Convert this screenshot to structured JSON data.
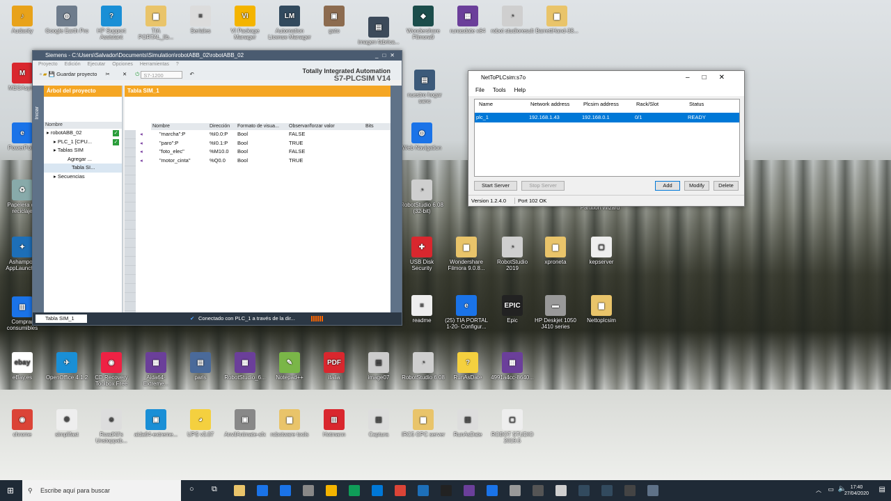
{
  "desktop": {
    "icons": [
      {
        "label": "Audacity",
        "color": "#e8a21a",
        "glyph": "♪"
      },
      {
        "label": "Google Earth Pro",
        "color": "#6e7c8c",
        "glyph": "◍"
      },
      {
        "label": "HP Support Assistant",
        "color": "#1a8fd6",
        "glyph": "?"
      },
      {
        "label": "TIA PORTAL_lib...",
        "color": "#e9c46a",
        "glyph": "▆"
      },
      {
        "label": "Seriales",
        "color": "#dcdcdc",
        "glyph": "≡"
      },
      {
        "label": "VI Package Manager",
        "color": "#f4b400",
        "glyph": "VI"
      },
      {
        "label": "Automation License Manager",
        "color": "#324a5e",
        "glyph": "LM"
      },
      {
        "label": "gato",
        "color": "#8c6b4f",
        "glyph": "▣"
      },
      {
        "label": "imagen fabrica...",
        "color": "#3c4a5a",
        "glyph": "▤"
      },
      {
        "label": "Wondershare Filmora9",
        "color": "#1b4d4b",
        "glyph": "◆"
      },
      {
        "label": "runasdate x64",
        "color": "#6b3f9a",
        "glyph": "▦"
      },
      {
        "label": "robot studioresult",
        "color": "#cfcfcf",
        "glyph": "◔"
      },
      {
        "label": "BarrettHand-38...",
        "color": "#e9c46a",
        "glyph": "▆"
      },
      {
        "label": "MEGAsync",
        "color": "#d9272e",
        "glyph": "M"
      },
      {
        "label": "PowerPoint",
        "color": "#1a73e8",
        "glyph": "e"
      },
      {
        "label": "Papelera de reciclaje",
        "color": "#8aa",
        "glyph": "♻"
      },
      {
        "label": "Ashampoo AppLauncher",
        "color": "#1d6fb8",
        "glyph": "✦"
      },
      {
        "label": "Comprar consumibles",
        "color": "#1a73e8",
        "glyph": "▥"
      },
      {
        "label": "nuestro hogar sano",
        "color": "#3c5a7a",
        "glyph": "▤"
      },
      {
        "label": "Web Navigation",
        "color": "#1a73e8",
        "glyph": "◍"
      },
      {
        "label": "RobotStudio 6.08 (32-bit)",
        "color": "#cfcfcf",
        "glyph": "◔"
      },
      {
        "label": "USB Disk Security",
        "color": "#d9272e",
        "glyph": "✚"
      },
      {
        "label": "Wondershare Filmora 9.0.8...",
        "color": "#e9c46a",
        "glyph": "▆"
      },
      {
        "label": "RobotStudio 2019",
        "color": "#cfcfcf",
        "glyph": "◔"
      },
      {
        "label": "xproneta",
        "color": "#e9c46a",
        "glyph": "▆"
      },
      {
        "label": "kepserver",
        "color": "#eee",
        "glyph": "▢"
      },
      {
        "label": "readme",
        "color": "#eee",
        "glyph": "≡"
      },
      {
        "label": "(25) TIA PORTAL 1-20- Configur...",
        "color": "#1a73e8",
        "glyph": "e"
      },
      {
        "label": "Epic",
        "color": "#222",
        "glyph": "EPIC"
      },
      {
        "label": "HP Deskjet 1050 J410 series",
        "color": "#999",
        "glyph": "▬"
      },
      {
        "label": "Nettoplcsim",
        "color": "#e9c46a",
        "glyph": "▆"
      },
      {
        "label": "eBay.es",
        "color": "#fff",
        "glyph": "ebay"
      },
      {
        "label": "OpenOffice 4.1.2",
        "color": "#1a8fd6",
        "glyph": "✈"
      },
      {
        "label": "CD Recovery Toolbox Free",
        "color": "#e24",
        "glyph": "◉"
      },
      {
        "label": "Aida64-Extreme...",
        "color": "#6b3f9a",
        "glyph": "▦"
      },
      {
        "label": "paris",
        "color": "#4a6a9a",
        "glyph": "▤"
      },
      {
        "label": "RobotStudio_6...",
        "color": "#6b3f9a",
        "glyph": "▦"
      },
      {
        "label": "Notepad++",
        "color": "#7ab648",
        "glyph": "✎"
      },
      {
        "label": "italia",
        "color": "#d9272e",
        "glyph": "PDF"
      },
      {
        "label": "image07",
        "color": "#ccc",
        "glyph": "▤"
      },
      {
        "label": "RobotStudio 6.08",
        "color": "#cfcfcf",
        "glyph": "◔"
      },
      {
        "label": "RunAsDate",
        "color": "#f4d03f",
        "glyph": "?"
      },
      {
        "label": "4991a4cc-8640...",
        "color": "#6b3f9a",
        "glyph": "▦"
      },
      {
        "label": "chrome",
        "color": "#db4437",
        "glyph": "◉"
      },
      {
        "label": "simplifast",
        "color": "#eee",
        "glyph": "⚙"
      },
      {
        "label": "RoadKil's Unstoppab...",
        "color": "#ddd",
        "glyph": "☻"
      },
      {
        "label": "aida64-extreme...",
        "color": "#1a8fd6",
        "glyph": "▣"
      },
      {
        "label": "UPS v3.87",
        "color": "#f4d03f",
        "glyph": "◕"
      },
      {
        "label": "AnvilAnimate-sfx",
        "color": "#888",
        "glyph": "▣"
      },
      {
        "label": "robotware tools",
        "color": "#e9c46a",
        "glyph": "▆"
      },
      {
        "label": "Hotmann",
        "color": "#d9272e",
        "glyph": "▥"
      },
      {
        "label": "Captura",
        "color": "#ddd",
        "glyph": "▦"
      },
      {
        "label": "IRC5 OPC server",
        "color": "#e9c46a",
        "glyph": "▆"
      },
      {
        "label": "RunAsDate",
        "color": "#ddd",
        "glyph": "▦"
      },
      {
        "label": "ROBOT STUDIO 2019.5",
        "color": "#eee",
        "glyph": "▢"
      },
      {
        "label": "Partition Wizard",
        "color": "#1a73e8",
        "glyph": "◍"
      }
    ]
  },
  "tia": {
    "title": "Siemens - C:\\Users\\Salvador\\Documents\\Simulation\\robotABB_02\\robotABB_02",
    "menu": [
      "Proyecto",
      "Edición",
      "Ejecutar",
      "Opciones",
      "Herramientas",
      "?"
    ],
    "save_label": "Guardar proyecto",
    "cpu_select": "S7-1200",
    "brand1": "Totally Integrated Automation",
    "brand2": "S7-PLCSIM V14",
    "side_label": "Iniciar",
    "tree_title": "Árbol del proyecto",
    "tree_col": "Nombre",
    "tree": [
      {
        "label": "robotABB_02",
        "ok": true,
        "indent": 4
      },
      {
        "label": "PLC_1 [CPU...",
        "ok": true,
        "indent": 14
      },
      {
        "label": "Tablas SIM",
        "ok": false,
        "indent": 14
      },
      {
        "label": "Agregar ...",
        "ok": false,
        "indent": 34
      },
      {
        "label": "Tabla SI...",
        "ok": false,
        "indent": 40
      },
      {
        "label": "Secuencias",
        "ok": false,
        "indent": 14
      }
    ],
    "table_title": "Tabla SIM_1",
    "columns": {
      "name": "Nombre",
      "addr": "Dirección",
      "fmt": "Formato de visua...",
      "obs": "Observar/forzar valor",
      "bits": "Bits"
    },
    "rows": [
      {
        "name": "\"marcha\":P",
        "addr": "%I0.0:P",
        "fmt": "Bool",
        "val": "FALSE"
      },
      {
        "name": "\"paro\":P",
        "addr": "%I0.1:P",
        "fmt": "Bool",
        "val": "TRUE"
      },
      {
        "name": "\"foto_elec\"",
        "addr": "%M10.0",
        "fmt": "Bool",
        "val": "FALSE"
      },
      {
        "name": "\"motor_cinta\"",
        "addr": "%Q0.0",
        "fmt": "Bool",
        "val": "TRUE"
      }
    ],
    "status_tab": "Tabla SIM_1",
    "status_msg": "Conectado con PLC_1 a través de la dir..."
  },
  "ntp": {
    "title": "NetToPLCsim:s7o",
    "menu": [
      "File",
      "Tools",
      "Help"
    ],
    "cols": {
      "name": "Name",
      "net": "Network address",
      "plc": "Plcsim address",
      "rack": "Rack/Slot",
      "status": "Status"
    },
    "row": {
      "name": "plc_1",
      "net": "192.168.1.43",
      "plc": "192.168.0.1",
      "rack": "0/1",
      "status": "READY"
    },
    "btn_start": "Start Server",
    "btn_stop": "Stop Server",
    "btn_add": "Add",
    "btn_modify": "Modify",
    "btn_delete": "Delete",
    "version": "Version 1.2.4.0",
    "port": "Port 102 OK"
  },
  "taskbar": {
    "search": "Escribe aquí para buscar",
    "time": "17:40",
    "date": "27/04/2020"
  }
}
